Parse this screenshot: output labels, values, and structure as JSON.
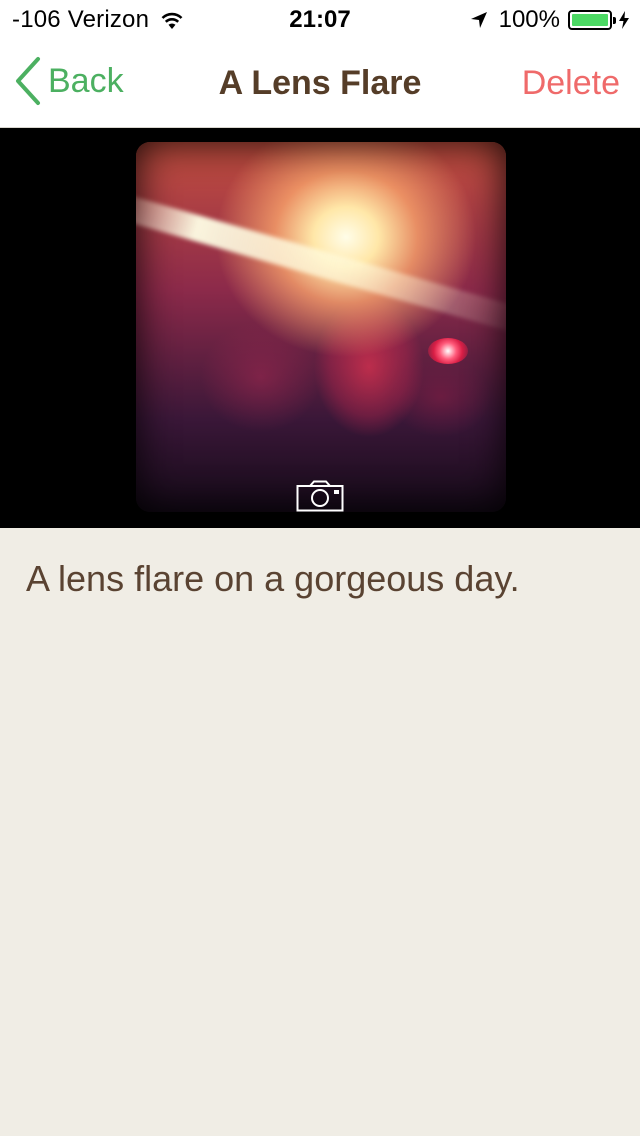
{
  "status_bar": {
    "carrier": "-106 Verizon",
    "time": "21:07",
    "battery_percent": "100%",
    "battery_level": 1.0,
    "icons": [
      "wifi-icon",
      "location-arrow-icon",
      "battery-icon",
      "charging-bolt-icon"
    ]
  },
  "nav": {
    "back_label": "Back",
    "title": "A Lens Flare",
    "delete_label": "Delete",
    "back_icon": "chevron-left-icon",
    "colors": {
      "back": "#4cb061",
      "title": "#553d28",
      "delete": "#ef6a6a"
    }
  },
  "photo": {
    "camera_icon": "camera-icon"
  },
  "note": {
    "text": "A lens flare on a gorgeous day."
  },
  "colors": {
    "background": "#f0ede5",
    "caption": "#5a4332",
    "battery": "#4cd964"
  }
}
